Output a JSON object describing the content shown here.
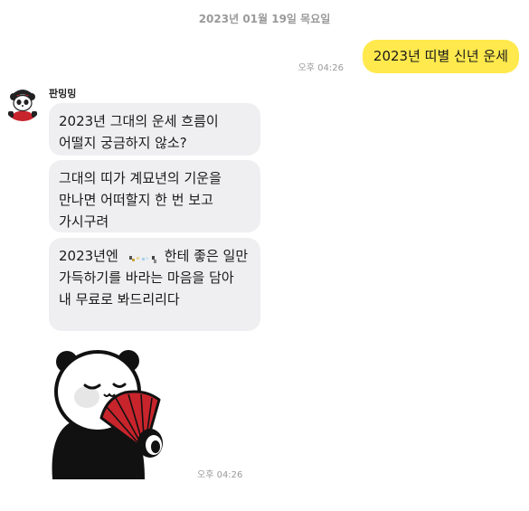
{
  "date_divider": "2023년 01월 19일 목요일",
  "outgoing": {
    "text": "2023년 띠별 신년 운세",
    "time": "오후 04:26"
  },
  "incoming": {
    "sender": "판밍밍",
    "messages": [
      "2023년 그대의 운세 흐름이 어떨지 궁금하지 않소?",
      "그대의 띠가 계묘년의 기운을 만나면 어떠할지 한 번 보고 가시구려"
    ],
    "third_before": "2023년엔",
    "third_after": "한테 좋은 일만 가득하기를 바라는 마음을 담아 내 무료로 봐드리리다",
    "time": "오후 04:26"
  },
  "colors": {
    "my_bubble": "#ffe94d",
    "their_bubble": "#efeff1",
    "fan": "#c8242c"
  },
  "icons": {
    "avatar": "panda-avatar-icon",
    "sticker": "panda-fan-sticker"
  }
}
